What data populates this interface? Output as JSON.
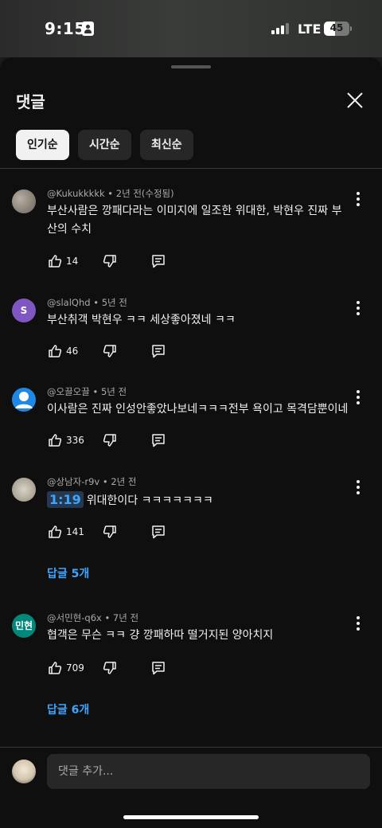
{
  "status_bar": {
    "time": "9:15",
    "network": "LTE",
    "battery": "45",
    "battery_level": 0.45,
    "signal_bars_active": 3,
    "signal_bars_total": 4
  },
  "sheet": {
    "title": "댓글",
    "close_icon": "close-icon",
    "sort_chips": [
      {
        "label": "인기순",
        "active": true
      },
      {
        "label": "시간순",
        "active": false
      },
      {
        "label": "최신순",
        "active": false
      }
    ]
  },
  "comments": [
    {
      "author": "@Kukukkkkk",
      "time": "2년 전(수정됨)",
      "text": "부산사람은 깡패다라는 이미지에 일조한 위대한, 박현우 진짜 부산의 수치",
      "likes": "14",
      "avatar": "photo"
    },
    {
      "author": "@slalQhd",
      "time": "5년 전",
      "text": "부산취객 박현우 ㅋㅋ 세상좋아졌네 ㅋㅋ",
      "likes": "46",
      "avatar_letter": "S"
    },
    {
      "author": "@오끌오끌",
      "time": "5년 전",
      "text": "이사람은 진짜 인성안좋았나보네ㅋㅋㅋ전부 욕이고 목격담뿐이네",
      "likes": "336",
      "avatar": "default-person"
    },
    {
      "author": "@상남자-r9v",
      "time": "2년 전",
      "timestamp": "1:19",
      "text": "위대한이다 ㅋㅋㅋㅋㅋㅋㅋ",
      "likes": "141",
      "replies": "답글 5개",
      "avatar": "photo"
    },
    {
      "author": "@서민현-q6x",
      "time": "7년 전",
      "text": "협객은 무슨 ㅋㅋ 걍 깡패하따 떨거지된 양아치지",
      "likes": "709",
      "replies": "답글 6개",
      "avatar_letter": "민현"
    }
  ],
  "composer": {
    "placeholder": "댓글 추가..."
  },
  "colors": {
    "background": "#0f0f0f",
    "text": "#f1f1f1",
    "meta": "#aaaaaa",
    "link": "#3ea6ff",
    "chip_active": "#f1f1f1",
    "chip_inactive": "#272727"
  }
}
